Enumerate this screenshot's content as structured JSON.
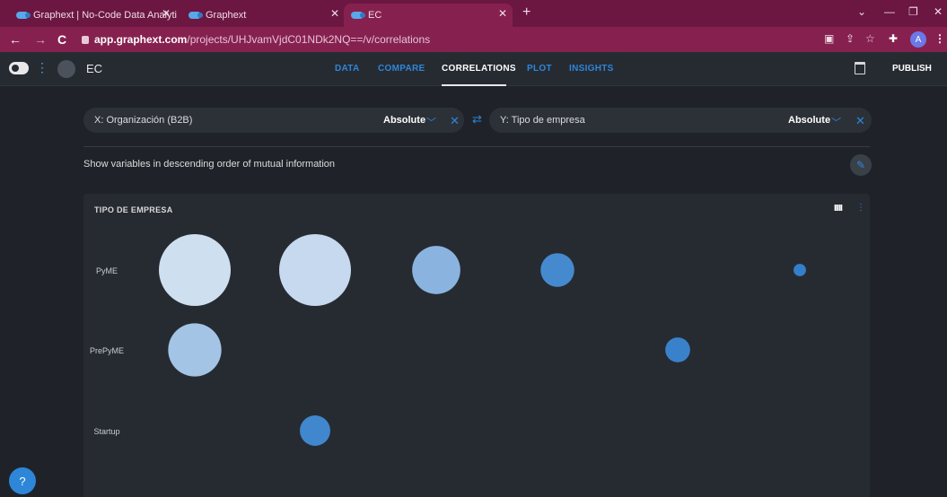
{
  "browser": {
    "tabs": [
      {
        "label": "Graphext | No-Code Data Analyti"
      },
      {
        "label": "Graphext"
      },
      {
        "label": "EC"
      }
    ],
    "url_host": "app.graphext.com",
    "url_path": "/projects/UHJvamVjdC01NDk2NQ==/v/correlations",
    "profile_initial": "A"
  },
  "header": {
    "project_name": "EC",
    "nav": [
      {
        "label": "DATA"
      },
      {
        "label": "COMPARE"
      },
      {
        "label": "CORRELATIONS"
      },
      {
        "label": "PLOT"
      },
      {
        "label": "INSIGHTS"
      }
    ],
    "active_tab": "CORRELATIONS",
    "publish_label": "PUBLISH"
  },
  "controls": {
    "x_variable": "X: Organización (B2B)",
    "x_mode": "Absolute",
    "y_variable": "Y: Tipo de empresa",
    "y_mode": "Absolute",
    "description": "Show variables in descending order of mutual information"
  },
  "chart": {
    "title": "TIPO DE EMPRESA",
    "menu_label": "IIIII"
  },
  "help_label": "?",
  "colors": {
    "accent": "#2e86d8",
    "tab_bar": "#6b1742",
    "address_bar": "#86214f",
    "background": "#1f2329",
    "panel": "#262b32"
  },
  "chart_data": {
    "type": "scatter",
    "title": "TIPO DE EMPRESA",
    "y_categories": [
      "PyME",
      "PrePyME",
      "Startup"
    ],
    "x_categories": [
      "",
      "",
      "",
      "",
      "",
      ""
    ],
    "points": [
      {
        "y": "PyME",
        "x_index": 0,
        "size": 100,
        "shade": 0.05
      },
      {
        "y": "PyME",
        "x_index": 1,
        "size": 100,
        "shade": 0.1
      },
      {
        "y": "PyME",
        "x_index": 2,
        "size": 45,
        "shade": 0.45
      },
      {
        "y": "PyME",
        "x_index": 3,
        "size": 22,
        "shade": 0.85
      },
      {
        "y": "PyME",
        "x_index": 5,
        "size": 3,
        "shade": 0.95
      },
      {
        "y": "PrePyME",
        "x_index": 0,
        "size": 55,
        "shade": 0.3
      },
      {
        "y": "PrePyME",
        "x_index": 4,
        "size": 12,
        "shade": 0.92
      },
      {
        "y": "Startup",
        "x_index": 1,
        "size": 18,
        "shade": 0.88
      }
    ]
  }
}
